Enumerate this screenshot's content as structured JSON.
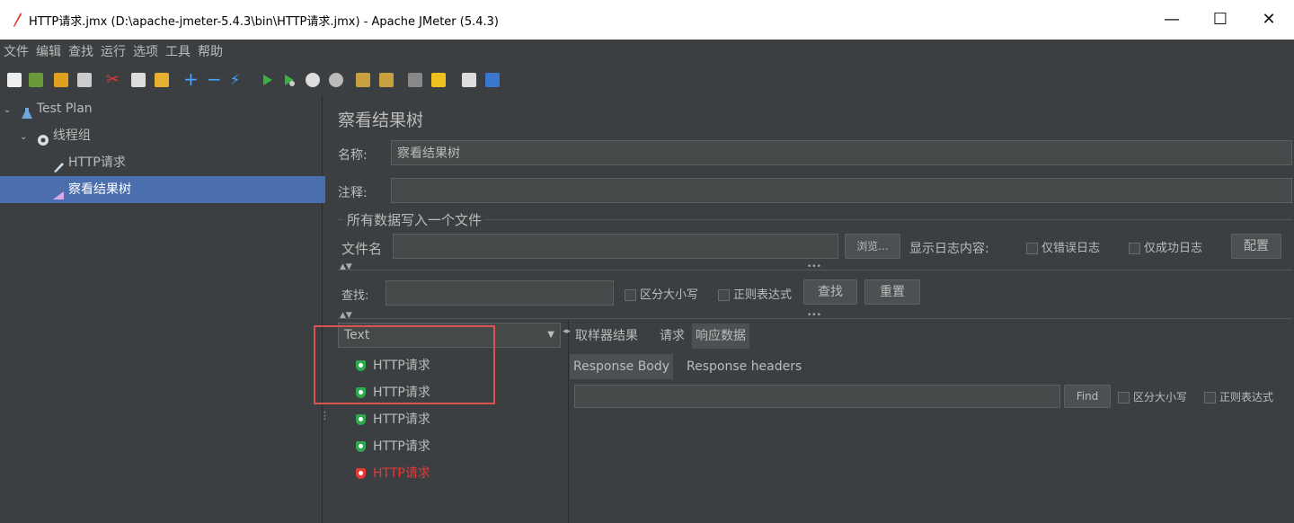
{
  "window": {
    "title": "HTTP请求.jmx (D:\\apache-jmeter-5.4.3\\bin\\HTTP请求.jmx) - Apache JMeter (5.4.3)",
    "minimize": "—",
    "maximize": "☐",
    "close": "✕"
  },
  "menu": [
    "文件",
    "编辑",
    "查找",
    "运行",
    "选项",
    "工具",
    "帮助"
  ],
  "tree": {
    "items": [
      {
        "label": "Test Plan",
        "icon": "flask-icon"
      },
      {
        "label": "线程组",
        "icon": "gear-icon"
      },
      {
        "label": "HTTP请求",
        "icon": "pen-icon"
      },
      {
        "label": "察看结果树",
        "icon": "chart-icon",
        "selected": true
      }
    ]
  },
  "panel": {
    "heading": "察看结果树",
    "name_label": "名称:",
    "name_value": "察看结果树",
    "comment_label": "注释:",
    "group_title": "所有数据写入一个文件",
    "file_label": "文件名",
    "browse_button": "浏览...",
    "log_label": "显示日志内容:",
    "errors_only": "仅错误日志",
    "success_only": "仅成功日志",
    "config_button": "配置",
    "search_label": "查找:",
    "case_sensitive": "区分大小写",
    "regex": "正则表达式",
    "find_button": "查找",
    "reset_button": "重置"
  },
  "results": {
    "renderer": "Text",
    "samples": [
      {
        "label": "HTTP请求",
        "status": "success"
      },
      {
        "label": "HTTP请求",
        "status": "success"
      },
      {
        "label": "HTTP请求",
        "status": "success"
      },
      {
        "label": "HTTP请求",
        "status": "success"
      },
      {
        "label": "HTTP请求",
        "status": "error"
      }
    ]
  },
  "detail": {
    "tabs": [
      "取样器结果",
      "请求",
      "响应数据"
    ],
    "subtabs": [
      "Response Body",
      "Response headers"
    ],
    "find_button": "Find",
    "case_sensitive": "区分大小写",
    "regex": "正则表达式"
  },
  "colors": {
    "success": "#2fa84f",
    "error": "#e53935",
    "selection": "#4b6eaf",
    "highlight": "#d9534f"
  }
}
